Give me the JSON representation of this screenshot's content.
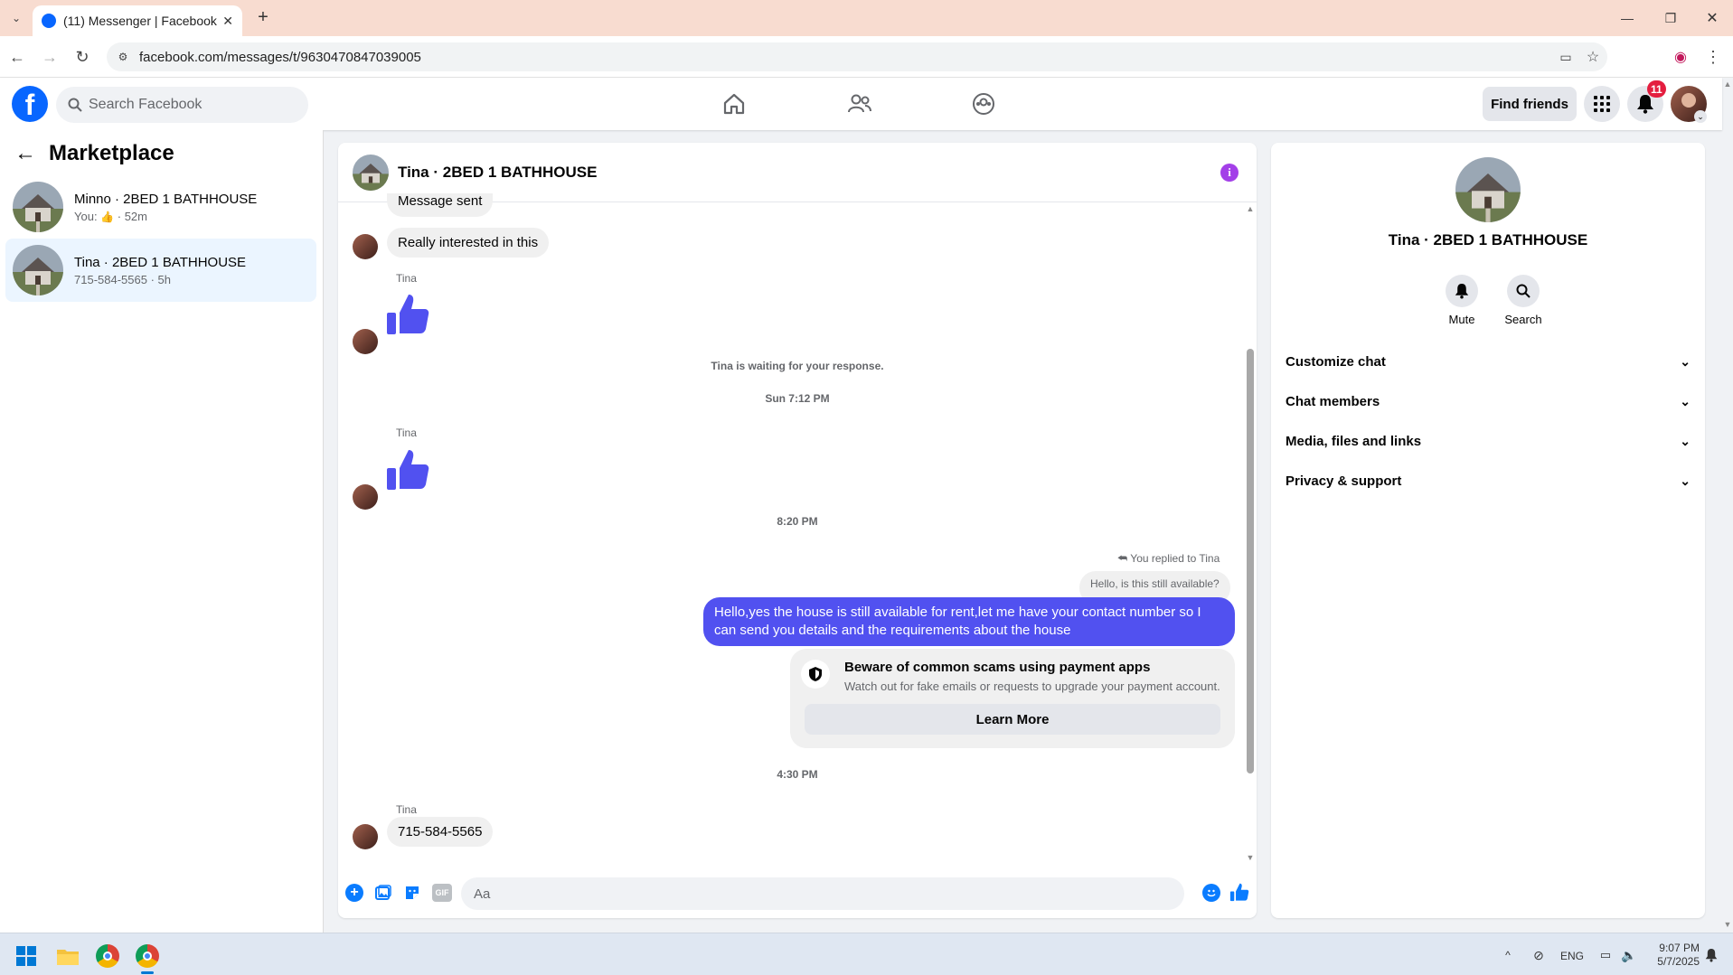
{
  "browser": {
    "tab_title": "(11) Messenger | Facebook",
    "url": "facebook.com/messages/t/9630470847039005"
  },
  "header": {
    "search_placeholder": "Search Facebook",
    "find_friends": "Find friends",
    "notification_count": "11"
  },
  "sidebar": {
    "title": "Marketplace",
    "conversations": [
      {
        "name": "Minno · 2BED 1 BATHHOUSE",
        "preview": "You:",
        "time": "· 52m"
      },
      {
        "name": "Tina · 2BED 1 BATHHOUSE",
        "preview": "715-584-5565 · 5h"
      }
    ]
  },
  "chat": {
    "title": "Tina · 2BED 1 BATHHOUSE",
    "messages": {
      "sent_status": "Message sent",
      "interested": "Really interested in this",
      "sender1": "Tina",
      "waiting": "Tina is waiting for your response.",
      "time1": "Sun 7:12 PM",
      "sender2": "Tina",
      "time2": "8:20 PM",
      "replied_to": "You replied to Tina",
      "quoted": "Hello, is this still available?",
      "outgoing": "Hello,yes the house is still available for rent,let me have your contact number   so I can send you details and the requirements about the house",
      "scam_title": "Beware of common scams using payment apps",
      "scam_body": "Watch out for fake emails or requests to upgrade your payment account.",
      "learn_more": "Learn More",
      "time3": "4:30 PM",
      "sender3": "Tina",
      "phone": "715-584-5565"
    },
    "composer_placeholder": "Aa"
  },
  "info_panel": {
    "name": "Tina · 2BED 1 BATHHOUSE",
    "mute": "Mute",
    "search": "Search",
    "sections": [
      "Customize chat",
      "Chat members",
      "Media, files and links",
      "Privacy & support"
    ]
  },
  "taskbar": {
    "lang": "ENG",
    "time": "9:07 PM",
    "date": "5/7/2025"
  },
  "colors": {
    "accent": "#0a7cff",
    "bubble_out": "#5151f0",
    "thumb": "#5151f0"
  }
}
